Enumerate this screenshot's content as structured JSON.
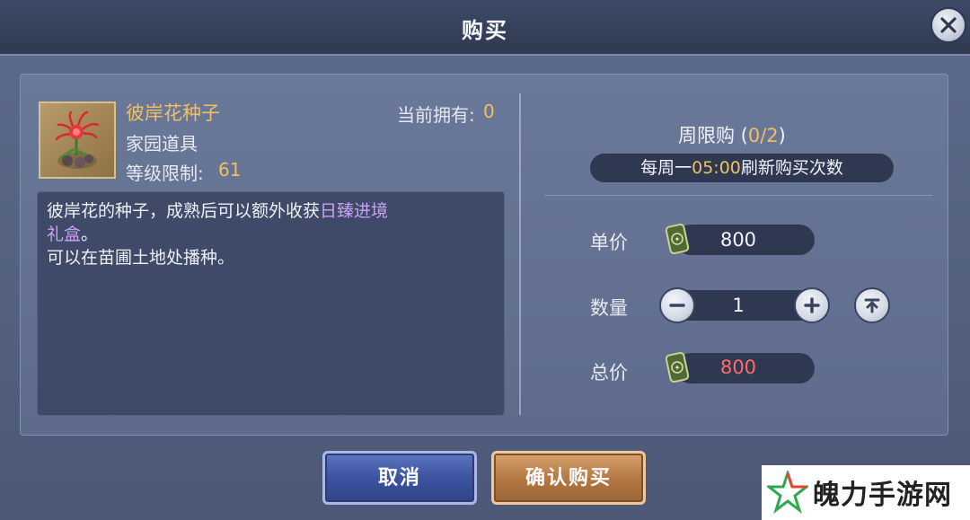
{
  "header": {
    "title": "购买"
  },
  "item": {
    "name": "彼岸花种子",
    "owned_label": "当前拥有:",
    "owned_value": "0",
    "type": "家园道具",
    "level_label": "等级限制:",
    "level_value": "61",
    "description": {
      "line1_prefix": "彼岸花的种子，成熟后可以额外收获",
      "line1_highlight": "日臻进境",
      "line2_highlight": "礼盒",
      "line2_suffix": "。",
      "line3": "可以在苗圃土地处播种。"
    }
  },
  "purchase": {
    "weekly_label": "周限购 (",
    "weekly_count": "0/2",
    "weekly_close": ")",
    "refresh_prefix": "每周一",
    "refresh_time": "05:00",
    "refresh_suffix": "刷新购买次数",
    "unit_price_label": "单价",
    "unit_price": "800",
    "quantity_label": "数量",
    "quantity": "1",
    "total_label": "总价",
    "total": "800"
  },
  "buttons": {
    "cancel": "取消",
    "confirm": "确认购买"
  },
  "watermark": {
    "text": "魄力手游网"
  },
  "icons": {
    "close": "close-icon",
    "item": "spider-lily-seed-icon",
    "currency": "jade-token-icon",
    "minus": "minus-icon",
    "plus": "plus-icon",
    "max": "max-icon"
  },
  "colors": {
    "gold": "#f0c060",
    "highlight": "#c7a3f2",
    "total_red": "#ff6b6b"
  }
}
